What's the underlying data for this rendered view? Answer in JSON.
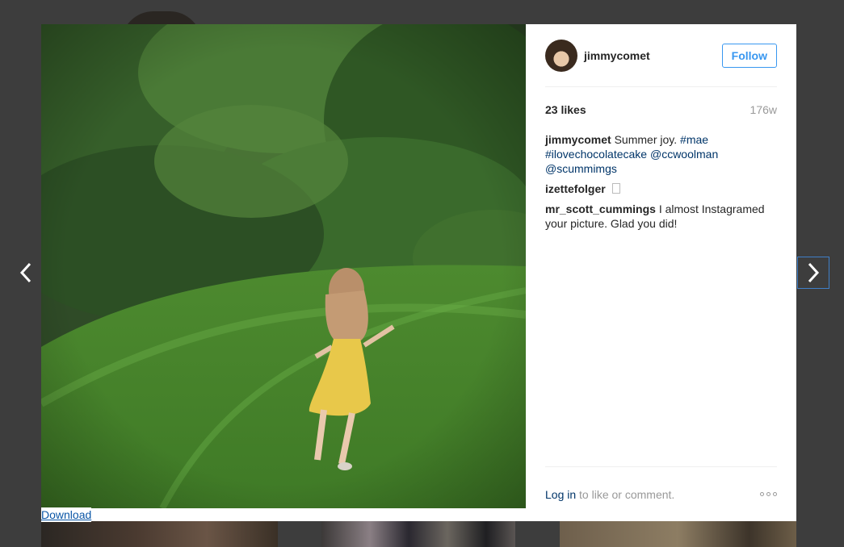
{
  "post": {
    "username": "jimmycomet",
    "follow_label": "Follow",
    "likes": "23 likes",
    "age": "176w",
    "photo_icon": "photo-girl-running-in-garden"
  },
  "comments": [
    {
      "author": "jimmycomet",
      "text": "Summer joy.",
      "tags": [
        "#mae",
        "#ilovechocolatecake",
        "@ccwoolman",
        "@scummimgs"
      ]
    },
    {
      "author": "izettefolger",
      "text": ""
    },
    {
      "author": "mr_scott_cummings",
      "text": "I almost Instagramed your picture. Glad you did!"
    }
  ],
  "footer": {
    "login_label": "Log in",
    "login_suffix": " to like or comment.",
    "more_icon": "more-options-icon"
  },
  "download_label": "Download",
  "colors": {
    "accent": "#3897f0",
    "link": "#003569",
    "overlay": "#3d3d3d"
  }
}
